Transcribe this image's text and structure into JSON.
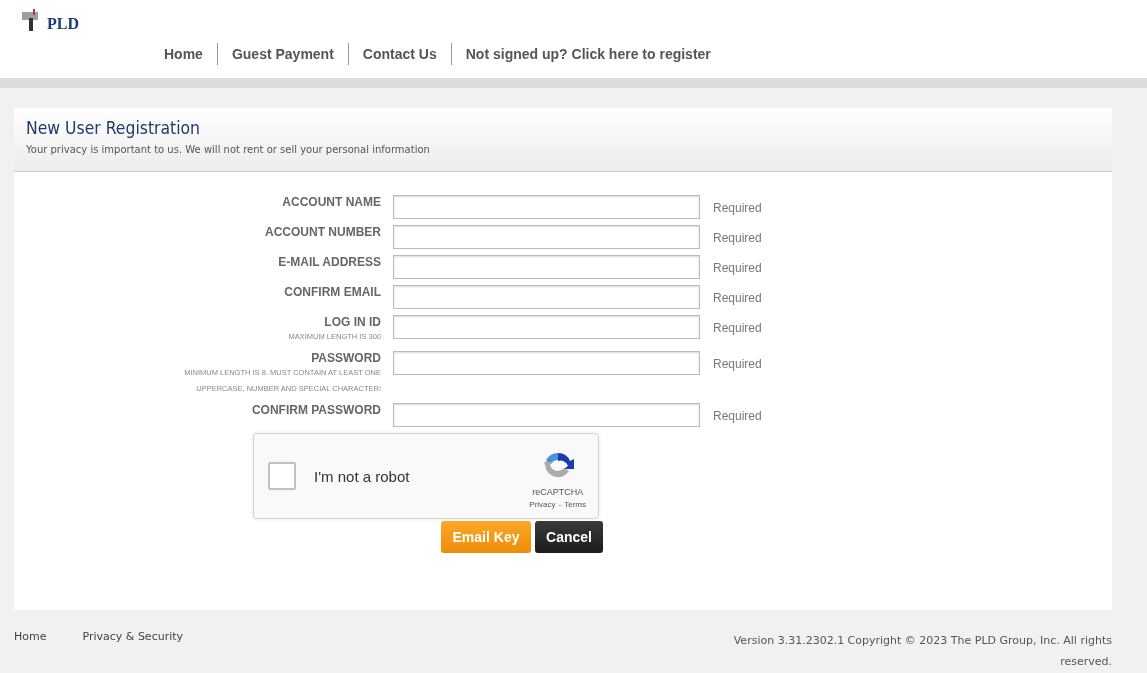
{
  "logo": {
    "text": "PLD"
  },
  "nav": [
    {
      "label": "Home"
    },
    {
      "label": "Guest Payment"
    },
    {
      "label": "Contact Us"
    },
    {
      "label": "Not signed up? Click here to register"
    }
  ],
  "panel": {
    "title": "New User Registration",
    "subtitle": "Your privacy is important to us. We will not rent or sell your personal information"
  },
  "fields": [
    {
      "label": "ACCOUNT NAME",
      "note": "Required"
    },
    {
      "label": "ACCOUNT NUMBER",
      "note": "Required"
    },
    {
      "label": "E-MAIL ADDRESS",
      "note": "Required"
    },
    {
      "label": "CONFIRM EMAIL",
      "note": "Required"
    },
    {
      "label": "LOG IN ID",
      "hint": "MAXIMUM LENGTH IS 300",
      "note": "Required"
    },
    {
      "label": "PASSWORD",
      "hint": "MINIMUM LENGTH IS 8. MUST CONTAIN AT LEAST ONE UPPERCASE, NUMBER AND SPECIAL CHARACTER!",
      "note": "Required"
    },
    {
      "label": "CONFIRM PASSWORD",
      "note": "Required"
    }
  ],
  "captcha": {
    "label": "I'm not a robot",
    "checked": false,
    "brand": "reCAPTCHA",
    "privacy": "Privacy",
    "separator": "-",
    "terms": "Terms"
  },
  "buttons": [
    {
      "label": "Email Key",
      "kind": "primary"
    },
    {
      "label": "Cancel",
      "kind": "secondary"
    }
  ],
  "footer": {
    "links": [
      "Home",
      "Privacy & Security"
    ],
    "copyright": "Version 3.31.2302.1 Copyright © 2023 The PLD Group, Inc. All rights reserved."
  }
}
